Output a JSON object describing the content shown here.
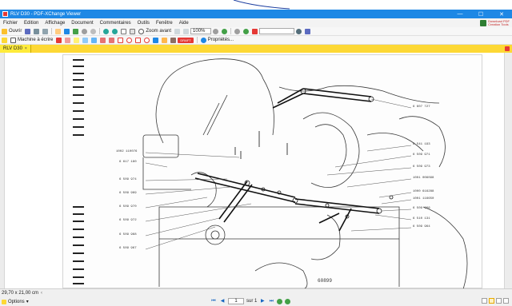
{
  "window": {
    "title": "RLV D30 - PDF-XChange Viewer",
    "minimize_glyph": "—",
    "maximize_glyph": "☐",
    "close_glyph": "✕"
  },
  "menu": {
    "items": [
      "Fichier",
      "Edition",
      "Affichage",
      "Document",
      "Commentaires",
      "Outils",
      "Fenêtre",
      "Aide"
    ],
    "badge_line1": "Download PDF",
    "badge_line2": "Creation Tools"
  },
  "toolbar": {
    "open_label": "Ouvrir",
    "zoom_mode_label": "Zoom avant",
    "zoom_value": "100%",
    "typewriter_label": "Machine à écrire",
    "stamp_label": "DRAFT",
    "properties_label": "Propriétés..."
  },
  "tabs": [
    {
      "label": "RLV D30",
      "close_glyph": "×"
    }
  ],
  "drawing": {
    "left_labels": [
      "1002 110076",
      "6 617 180",
      "6 509 974",
      "6 509 969",
      "6 509 970",
      "6 509 972",
      "6 509 968",
      "6 509 967"
    ],
    "right_labels": [
      "6 607 727",
      "6 541 193",
      "6 509 971",
      "6 509 973",
      "1001 006098",
      "1000 616288",
      "1001 116650",
      "6 509 966",
      "6 510 131",
      "6 509 964"
    ],
    "figure_number": "60899"
  },
  "status": {
    "page_size": "29,70 x 21,00 cm",
    "options_label": "Options",
    "current_page": "1",
    "page_of": "sur 1"
  },
  "colors": {
    "title_bar": "#1e88e5",
    "tab_bar": "#fdd835",
    "accent_red": "#e53935"
  }
}
